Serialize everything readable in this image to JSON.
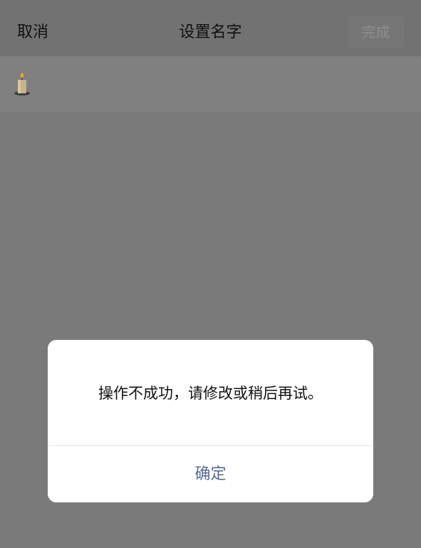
{
  "nav": {
    "cancel_label": "取消",
    "title": "设置名字",
    "done_label": "完成"
  },
  "name_field": {
    "icon": "candle-icon"
  },
  "dialog": {
    "message": "操作不成功，请修改或稍后再试。",
    "confirm_label": "确定"
  },
  "colors": {
    "overlay": "#7a7a7a",
    "dialog_bg": "#ffffff",
    "confirm_text": "#576b95",
    "done_disabled_text": "#8e8e8e"
  }
}
